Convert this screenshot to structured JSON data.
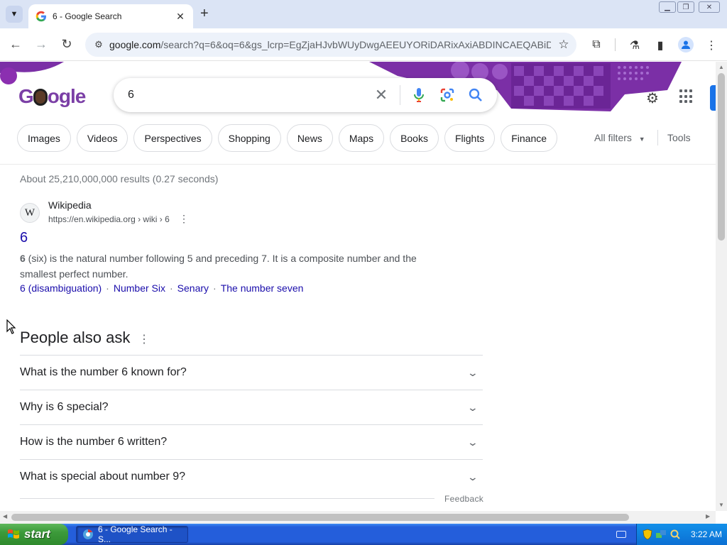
{
  "browser": {
    "tab_title": "6 - Google Search",
    "url_host": "google.com",
    "url_rest": "/search?q=6&oq=6&gs_lcrp=EgZjaHJvbWUyDwgAEEUYORiDARixAxiABDINCAEQABiD..."
  },
  "search": {
    "query": "6"
  },
  "chips": [
    "Images",
    "Videos",
    "Perspectives",
    "Shopping",
    "News",
    "Maps",
    "Books",
    "Flights",
    "Finance"
  ],
  "filters": {
    "all_filters": "All filters",
    "tools": "Tools"
  },
  "stats": "About 25,210,000,000 results (0.27 seconds)",
  "result": {
    "favicon_letter": "W",
    "site": "Wikipedia",
    "cite": "https://en.wikipedia.org › wiki › 6",
    "title": "6",
    "snippet_bold": "6",
    "snippet_rest": " (six) is the natural number following 5 and preceding 7. It is a composite number and the smallest perfect number.",
    "sitelinks": [
      "6 (disambiguation)",
      "Number Six",
      "Senary",
      "The number seven"
    ]
  },
  "paa": {
    "title": "People also ask",
    "questions": [
      "What is the number 6 known for?",
      "Why is 6 special?",
      "How is the number 6 written?",
      "What is special about number 9?"
    ],
    "feedback": "Feedback"
  },
  "taskbar": {
    "start": "start",
    "window_button": "6 - Google Search - S...",
    "clock": "3:22 AM"
  },
  "colors": {
    "link": "#1a0dab",
    "doodle_purple": "#7b2fa6",
    "accent_blue": "#1a73e8"
  }
}
